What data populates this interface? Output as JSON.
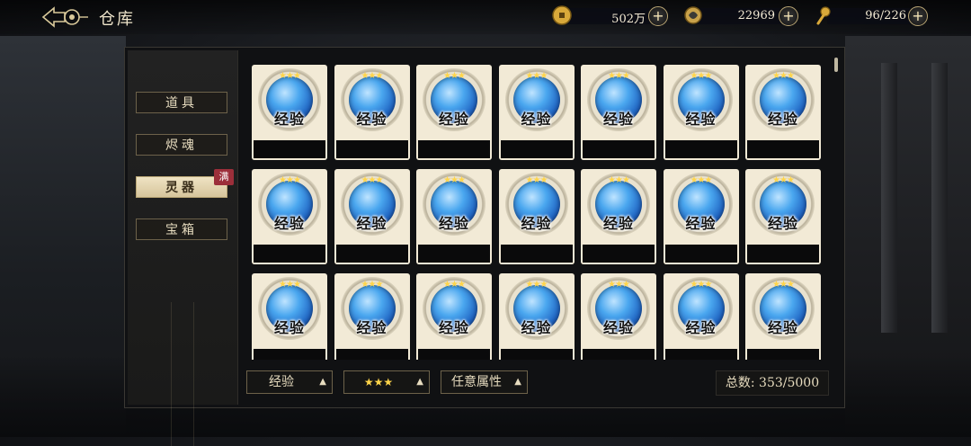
{
  "header": {
    "title": "仓库",
    "back_icon": "back-ornament-icon"
  },
  "resources": [
    {
      "icon": "coin-icon",
      "value": "502万"
    },
    {
      "icon": "gem-coin-icon",
      "value": "22969"
    },
    {
      "icon": "stamina-icon",
      "value": "96/226"
    }
  ],
  "sidebar": {
    "items": [
      {
        "label": "道具",
        "active": false
      },
      {
        "label": "烬魂",
        "active": false
      },
      {
        "label": "灵器",
        "active": true,
        "badge": "满"
      },
      {
        "label": "宝箱",
        "active": false
      }
    ]
  },
  "grid": {
    "item_label": "经验",
    "item_stars": "★★★",
    "columns": 7,
    "rows": 3
  },
  "filters": {
    "type": "经验",
    "stars": "★★★",
    "attribute": "任意属性",
    "sort_icon": "sort-arrows-icon"
  },
  "total": "总数: 353/5000",
  "colors": {
    "accent_gold": "#b9a574",
    "card_bg": "#f2ead6",
    "badge_red": "#9c2f3a",
    "crystal_blue": "#2f7fd8"
  }
}
